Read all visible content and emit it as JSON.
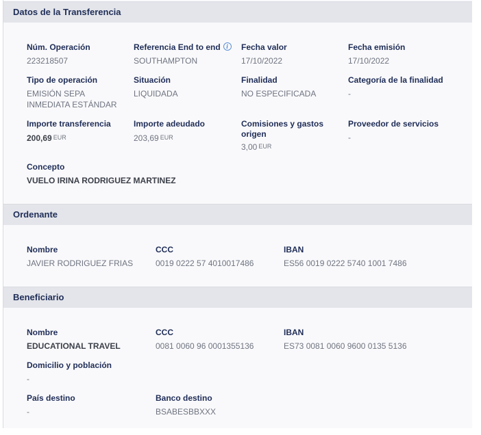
{
  "transfer": {
    "header": "Datos de la Transferencia",
    "num_operacion": {
      "label": "Núm. Operación",
      "value": "223218507"
    },
    "referencia": {
      "label": "Referencia End to end",
      "value": "SOUTHAMPTON"
    },
    "fecha_valor": {
      "label": "Fecha valor",
      "value": "17/10/2022"
    },
    "fecha_emision": {
      "label": "Fecha emisión",
      "value": "17/10/2022"
    },
    "tipo_operacion": {
      "label": "Tipo de operación",
      "value": "EMISIÓN SEPA INMEDIATA ESTÁNDAR"
    },
    "situacion": {
      "label": "Situación",
      "value": "LIQUIDADA"
    },
    "finalidad": {
      "label": "Finalidad",
      "value": "NO ESPECIFICADA"
    },
    "categoria_finalidad": {
      "label": "Categoría de la finalidad",
      "value": "-"
    },
    "importe_transferencia": {
      "label": "Importe transferencia",
      "value": "200,69",
      "currency": "EUR"
    },
    "importe_adeudado": {
      "label": "Importe adeudado",
      "value": "203,69",
      "currency": "EUR"
    },
    "comisiones": {
      "label": "Comisiones y gastos origen",
      "value": "3,00",
      "currency": "EUR"
    },
    "proveedor": {
      "label": "Proveedor de servicios",
      "value": "-"
    },
    "concepto": {
      "label": "Concepto",
      "value": "VUELO IRINA RODRIGUEZ MARTINEZ"
    }
  },
  "ordenante": {
    "header": "Ordenante",
    "nombre": {
      "label": "Nombre",
      "value": "JAVIER RODRIGUEZ FRIAS"
    },
    "ccc": {
      "label": "CCC",
      "value": "0019 0222 57 4010017486"
    },
    "iban": {
      "label": "IBAN",
      "value": "ES56 0019 0222 5740 1001 7486"
    }
  },
  "beneficiario": {
    "header": "Beneficiario",
    "nombre": {
      "label": "Nombre",
      "value": "EDUCATIONAL TRAVEL"
    },
    "ccc": {
      "label": "CCC",
      "value": "0081 0060 96 0001355136"
    },
    "iban": {
      "label": "IBAN",
      "value": "ES73 0081 0060 9600 0135 5136"
    },
    "domicilio": {
      "label": "Domicilio y población",
      "value": "-"
    },
    "pais": {
      "label": "País destino",
      "value": "-"
    },
    "banco": {
      "label": "Banco destino",
      "value": "BSABESBBXXX"
    }
  },
  "icons": {
    "referencia_info": "info-icon"
  }
}
